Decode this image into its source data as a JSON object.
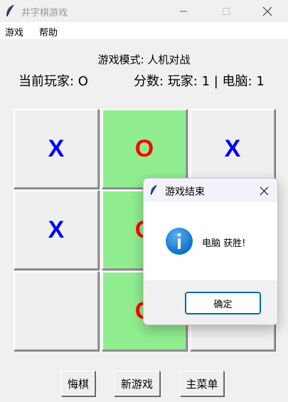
{
  "window": {
    "title": "井字棋游戏",
    "icon": "feather-icon",
    "controls": [
      "minimize-icon",
      "maximize-icon",
      "close-icon"
    ]
  },
  "menu": {
    "items": [
      "游戏",
      "帮助"
    ]
  },
  "status": {
    "mode": "游戏模式: 人机对战",
    "current_player": "当前玩家: O",
    "score": "分数: 玩家: 1 | 电脑: 1"
  },
  "board": {
    "cells": [
      "X",
      "O",
      "X",
      "X",
      "O",
      "",
      "",
      "O",
      ""
    ],
    "winning_color": "#90ee90",
    "x_color": "#0000ff",
    "o_color": "#ff0000"
  },
  "buttons": {
    "undo": "悔棋",
    "new_game": "新游戏",
    "main_menu": "主菜单"
  },
  "dialog": {
    "title": "游戏结束",
    "icon": "info-icon",
    "message": "电脑 获胜!",
    "ok": "确定"
  }
}
